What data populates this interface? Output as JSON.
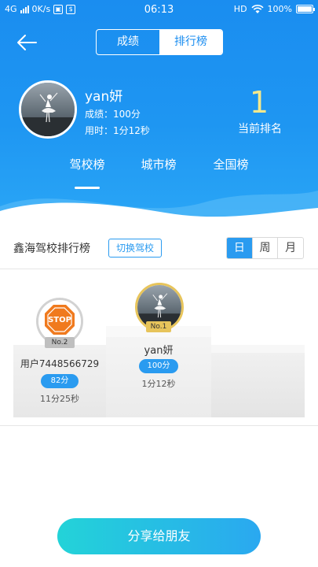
{
  "status_bar": {
    "network": "4G",
    "speed": "0K/s",
    "time": "06:13",
    "hd": "HD",
    "battery": "100%"
  },
  "nav": {
    "tabs": [
      {
        "label": "成绩",
        "active": false
      },
      {
        "label": "排行榜",
        "active": true
      }
    ]
  },
  "user": {
    "name": "yan妍",
    "score": "成绩：100分",
    "time": "用时：1分12秒",
    "rank": "1",
    "rank_label": "当前排名"
  },
  "scope_tabs": [
    "驾校榜",
    "城市榜",
    "全国榜"
  ],
  "ranking": {
    "title": "鑫海驾校排行榜",
    "switch_label": "切换驾校",
    "periods": [
      {
        "label": "日",
        "active": true
      },
      {
        "label": "周",
        "active": false
      },
      {
        "label": "月",
        "active": false
      }
    ]
  },
  "podium": {
    "first": {
      "badge": "No.1",
      "name": "yan妍",
      "score": "100分",
      "time": "1分12秒"
    },
    "second": {
      "badge": "No.2",
      "name": "用户7448566729",
      "score": "82分",
      "time": "11分25秒",
      "avatar_text": "STOP"
    }
  },
  "share_label": "分享给朋友",
  "colors": {
    "header_blue": "#1a8df0",
    "accent_blue": "#2a9bf0",
    "rank_yellow": "#f7e98c",
    "gold": "#e7c45b",
    "share_gradient_start": "#23d3d8",
    "share_gradient_end": "#2aa8f0"
  }
}
